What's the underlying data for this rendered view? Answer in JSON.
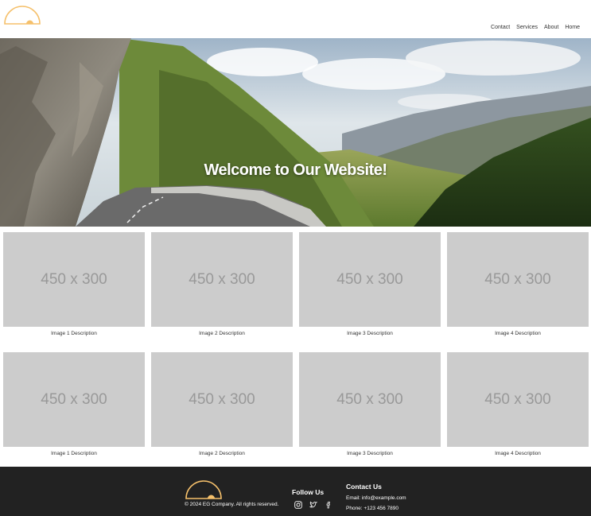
{
  "brand": {
    "logo": "half-sun-logo",
    "accent": "#f5c06b"
  },
  "nav": {
    "items": [
      "Contact",
      "Services",
      "About",
      "Home"
    ]
  },
  "hero": {
    "title": "Welcome to Our Website!"
  },
  "gallery": {
    "rows": [
      [
        {
          "placeholder": "450 x 300",
          "caption": "Image 1 Description"
        },
        {
          "placeholder": "450 x 300",
          "caption": "Image 2 Description"
        },
        {
          "placeholder": "450 x 300",
          "caption": "Image 3 Description"
        },
        {
          "placeholder": "450 x 300",
          "caption": "Image 4 Description"
        }
      ],
      [
        {
          "placeholder": "450 x 300",
          "caption": "Image 1 Description"
        },
        {
          "placeholder": "450 x 300",
          "caption": "Image 2 Description"
        },
        {
          "placeholder": "450 x 300",
          "caption": "Image 3 Description"
        },
        {
          "placeholder": "450 x 300",
          "caption": "Image 4 Description"
        }
      ]
    ]
  },
  "footer": {
    "copyright": "© 2024 EG Company. All rights reserved.",
    "follow_title": "Follow Us",
    "social": [
      "instagram-icon",
      "twitter-icon",
      "facebook-icon"
    ],
    "contact_title": "Contact Us",
    "email": "Email: info@example.com",
    "phone": "Phone: +123 456 7890"
  }
}
